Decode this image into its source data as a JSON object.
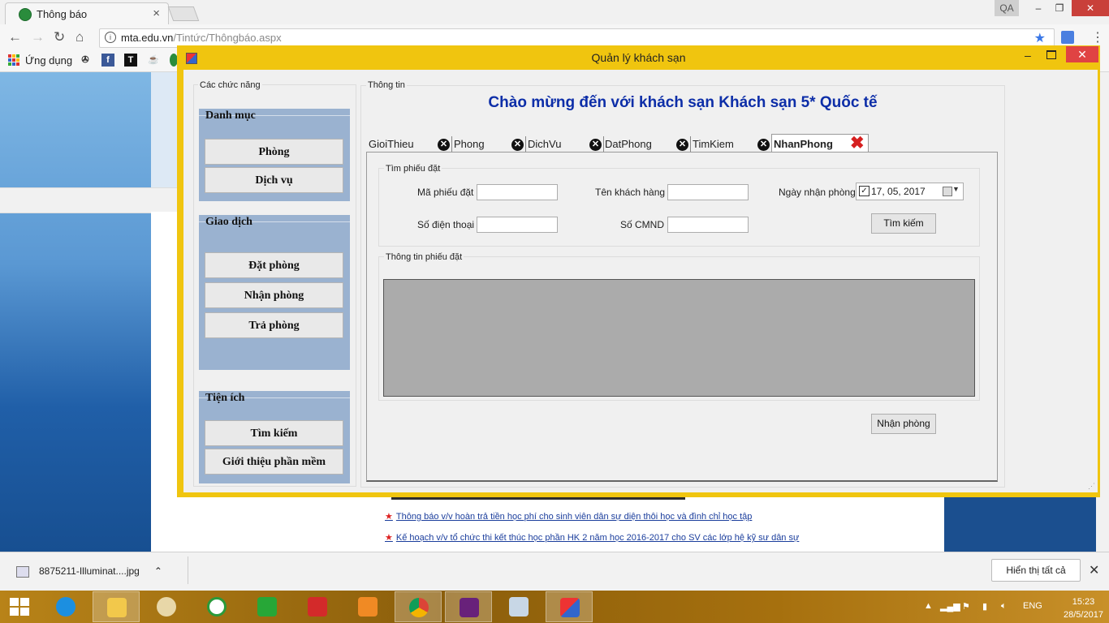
{
  "browser": {
    "tab_title": "Thông báo",
    "tab_close": "×",
    "window_user": "QA",
    "window_min": "–",
    "window_max": "❐",
    "window_close": "✕",
    "url_host": "mta.edu.vn",
    "url_path": "/Tintức/Thôngbáo.aspx",
    "bookmarks_label": "Ứng dụng"
  },
  "page": {
    "news": [
      "Thông báo v/v hoàn trả tiền học phí cho sinh viên dân sự diện thôi học và đình chỉ học tập",
      "Kế hoạch v/v tổ chức thi kết thúc học phần HK 2 năm học 2016-2017 cho SV các lớp hệ kỹ sư dân sự"
    ]
  },
  "downloads": {
    "file_name": "8875211-Illuminat....jpg",
    "show_all": "Hiển thị tất cả",
    "close": "✕"
  },
  "taskbar": {
    "lang": "ENG",
    "time": "15:23",
    "date": "28/5/2017"
  },
  "app": {
    "title": "Quản lý khách sạn",
    "functions_group": "Các chức năng",
    "sections": {
      "danh_muc": {
        "title": "Danh mục",
        "buttons": [
          "Phòng",
          "Dịch vụ"
        ]
      },
      "giao_dich": {
        "title": "Giao dịch",
        "buttons": [
          "Đặt phòng",
          "Nhận phòng",
          "Trả phòng"
        ]
      },
      "tien_ich": {
        "title": "Tiện ích",
        "buttons": [
          "Tìm kiếm",
          "Giới thiệu phần mềm"
        ]
      }
    },
    "info_group": "Thông tin",
    "welcome": "Chào mừng đến với khách sạn Khách sạn 5* Quốc tế",
    "tabs": [
      "GioiThieu",
      "Phong",
      "DichVu",
      "DatPhong",
      "TimKiem",
      "NhanPhong"
    ],
    "active_tab": "NhanPhong",
    "search_group": "Tìm phiếu đặt",
    "labels": {
      "ma_phieu": "Mã phiếu đặt",
      "ten_khach": "Tên khách hàng",
      "ngay_nhan": "Ngày nhận phòng",
      "sdt": "Số điện thoại",
      "cmnd": "Số CMND"
    },
    "fields": {
      "ma_phieu": "",
      "ten_khach": "",
      "sdt": "",
      "cmnd": "",
      "ngay_nhan": "17, 05, 2017",
      "ngay_nhan_checked": true
    },
    "search_button": "Tìm kiếm",
    "booking_info_group": "Thông tin phiếu đặt",
    "checkin_button": "Nhận phòng"
  }
}
